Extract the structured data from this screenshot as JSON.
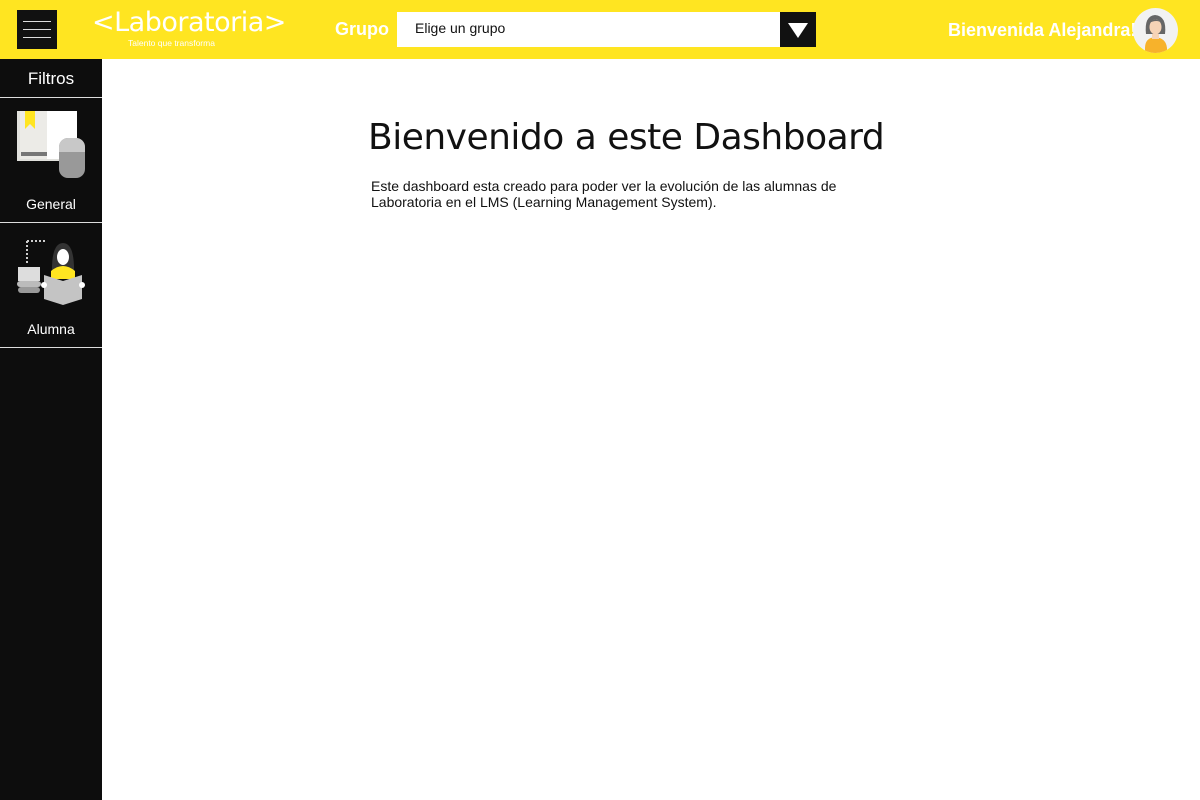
{
  "header": {
    "logo": "<Laboratoria>",
    "tagline": "Talento que transforma",
    "group_label": "Grupo",
    "group_select": {
      "selected": "Elige un grupo"
    },
    "welcome": "Bienvenida Alejandra!"
  },
  "sidebar": {
    "title": "Filtros",
    "items": [
      {
        "label": "General",
        "icon": "book-mouse-icon"
      },
      {
        "label": "Alumna",
        "icon": "student-reading-icon"
      }
    ]
  },
  "main": {
    "title": "Bienvenido a este Dashboard",
    "description": "Este dashboard esta creado para poder ver la evolución de las alumnas de Laboratoria en el LMS (Learning Management System)."
  },
  "colors": {
    "brand_yellow": "#FFE521",
    "sidebar": "#0D0D0D"
  }
}
